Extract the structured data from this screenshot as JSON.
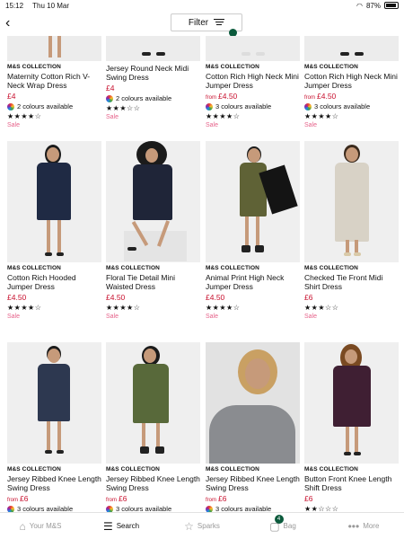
{
  "status": {
    "time": "15:12",
    "date": "Thu 10 Mar",
    "battery": "87%"
  },
  "nav": {
    "back_icon": "chevron-left-icon",
    "filter_label": "Filter",
    "filter_active_color": "#0b5a3c"
  },
  "products": [
    {
      "brand": "M&S COLLECTION",
      "title": "Maternity Cotton Rich V-Neck Wrap Dress",
      "from": "",
      "price": "£4",
      "colours": "2 colours available",
      "stars": "★★★★☆",
      "sale": "Sale"
    },
    {
      "brand": "",
      "title": "Jersey Round Neck Midi Swing Dress",
      "from": "",
      "price": "£4",
      "colours": "2 colours available",
      "stars": "★★★☆☆",
      "sale": "Sale"
    },
    {
      "brand": "M&S COLLECTION",
      "title": "Cotton Rich High Neck Mini Jumper Dress",
      "from": "from",
      "price": "£4.50",
      "colours": "3 colours available",
      "stars": "★★★★☆",
      "sale": "Sale"
    },
    {
      "brand": "M&S COLLECTION",
      "title": "Cotton Rich High Neck Mini Jumper Dress",
      "from": "from",
      "price": "£4.50",
      "colours": "3 colours available",
      "stars": "★★★★☆",
      "sale": "Sale"
    },
    {
      "brand": "M&S COLLECTION",
      "title": "Cotton Rich Hooded Jumper Dress",
      "from": "",
      "price": "£4.50",
      "colours": "",
      "stars": "★★★★☆",
      "sale": "Sale"
    },
    {
      "brand": "M&S COLLECTION",
      "title": "Floral Tie Detail Mini Waisted Dress",
      "from": "",
      "price": "£4.50",
      "colours": "",
      "stars": "★★★★☆",
      "sale": "Sale"
    },
    {
      "brand": "M&S COLLECTION",
      "title": "Animal Print High Neck Jumper Dress",
      "from": "",
      "price": "£4.50",
      "colours": "",
      "stars": "★★★★☆",
      "sale": "Sale"
    },
    {
      "brand": "M&S COLLECTION",
      "title": "Checked Tie Front Midi Shirt Dress",
      "from": "",
      "price": "£6",
      "colours": "",
      "stars": "★★★☆☆",
      "sale": "Sale"
    },
    {
      "brand": "M&S COLLECTION",
      "title": "Jersey Ribbed Knee Length Swing Dress",
      "from": "from",
      "price": "£6",
      "colours": "3 colours available",
      "stars": "",
      "sale": ""
    },
    {
      "brand": "M&S COLLECTION",
      "title": "Jersey Ribbed Knee Length Swing Dress",
      "from": "from",
      "price": "£6",
      "colours": "3 colours available",
      "stars": "",
      "sale": ""
    },
    {
      "brand": "M&S COLLECTION",
      "title": "Jersey Ribbed Knee Length Swing Dress",
      "from": "from",
      "price": "£6",
      "colours": "3 colours available",
      "stars": "",
      "sale": ""
    },
    {
      "brand": "M&S COLLECTION",
      "title": "Button Front Knee Length Shift Dress",
      "from": "",
      "price": "£6",
      "colours": "",
      "stars": "★★☆☆☆",
      "sale": ""
    }
  ],
  "tabs": [
    {
      "label": "Your M&S",
      "icon": "home-icon"
    },
    {
      "label": "Search",
      "icon": "search-icon"
    },
    {
      "label": "Sparks",
      "icon": "star-icon"
    },
    {
      "label": "Bag",
      "icon": "bag-icon",
      "badge": "4"
    },
    {
      "label": "More",
      "icon": "more-icon"
    }
  ],
  "colors": {
    "price": "#c8102e",
    "sale": "#e6628a",
    "brand_green": "#0b5a3c"
  }
}
